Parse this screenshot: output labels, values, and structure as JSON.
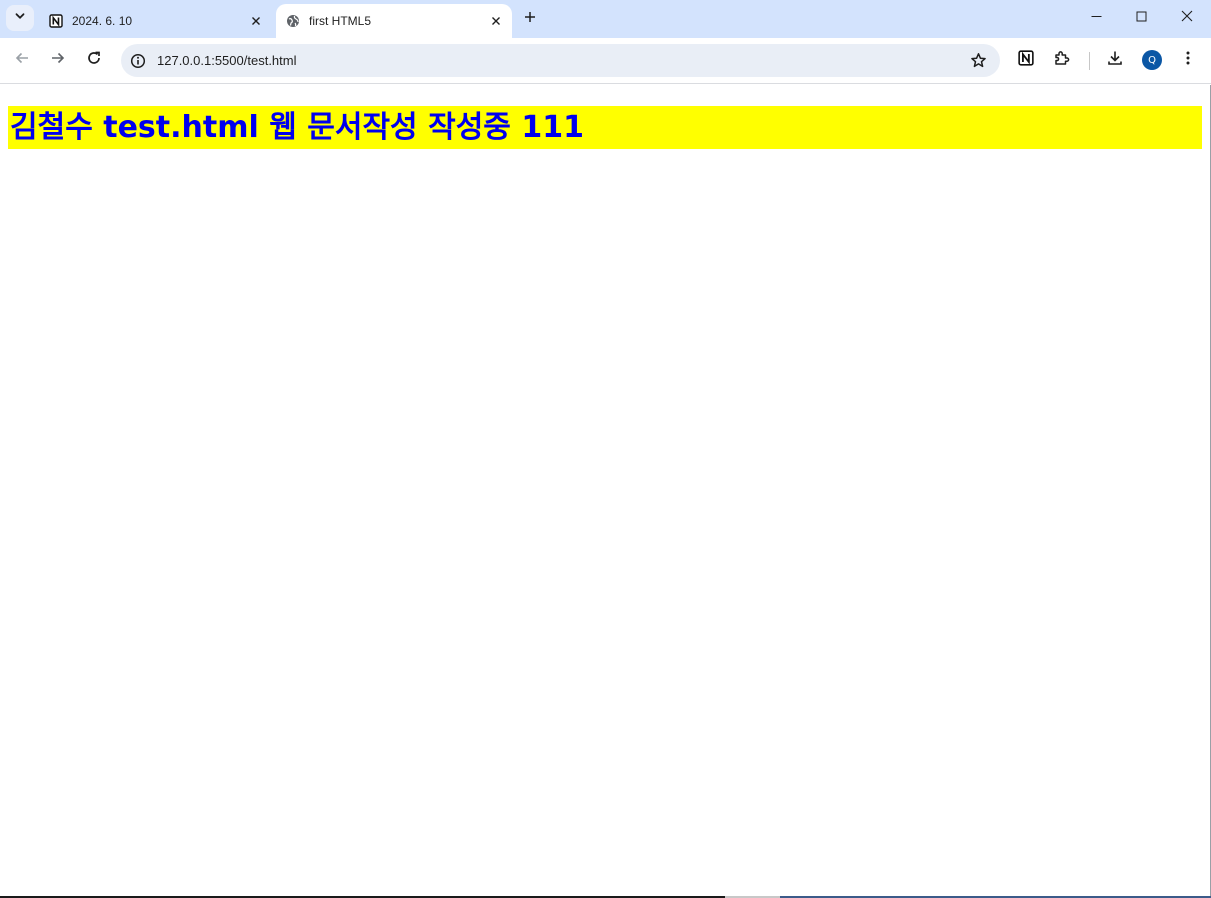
{
  "tabs": [
    {
      "title": "2024. 6. 10",
      "favicon": "notion-icon",
      "active": false
    },
    {
      "title": "first HTML5",
      "favicon": "globe-icon",
      "active": true
    }
  ],
  "toolbar": {
    "url": "127.0.0.1:5500/test.html",
    "profile_initial": "Q"
  },
  "page": {
    "heading": "김철수 test.html 웹 문서작성 작성중 111"
  },
  "colors": {
    "heading_bg": "#ffff00",
    "heading_text": "#0000ee",
    "tabstrip_bg": "#d3e3fd",
    "avatar_bg": "#0b57a5"
  }
}
